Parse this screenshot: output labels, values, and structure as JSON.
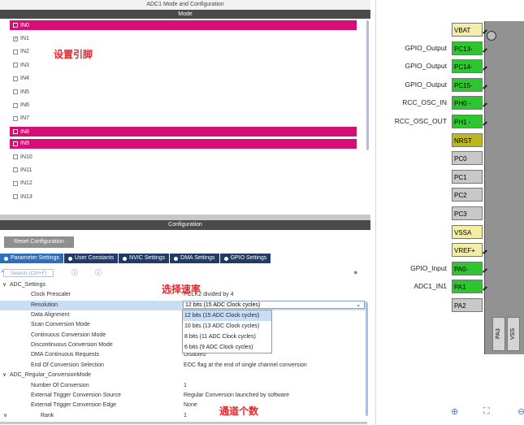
{
  "window_title": "ADC1 Mode and Configuration",
  "mode_header": "Mode",
  "channels": [
    {
      "label": "IN0",
      "selected": true,
      "checked": false
    },
    {
      "label": "IN1",
      "selected": false,
      "checked": true
    },
    {
      "label": "IN2",
      "selected": false,
      "checked": false
    },
    {
      "label": "IN3",
      "selected": false,
      "checked": false
    },
    {
      "label": "IN4",
      "selected": false,
      "checked": false
    },
    {
      "label": "IN5",
      "selected": false,
      "checked": false
    },
    {
      "label": "IN6",
      "selected": false,
      "checked": false
    },
    {
      "label": "IN7",
      "selected": false,
      "checked": false
    },
    {
      "label": "IN8",
      "selected": true,
      "checked": false
    },
    {
      "label": "IN9",
      "selected": true,
      "checked": false
    },
    {
      "label": "IN10",
      "selected": false,
      "checked": false
    },
    {
      "label": "IN11",
      "selected": false,
      "checked": false
    },
    {
      "label": "IN12",
      "selected": false,
      "checked": false
    },
    {
      "label": "IN13",
      "selected": false,
      "checked": false
    }
  ],
  "annotations": {
    "set_pin": "设置引脚",
    "select_speed": "选择速率",
    "channel_count": "通道个数"
  },
  "config_header": "Configuration",
  "reset_label": "Reset Configuration",
  "tabs": [
    "Parameter Settings",
    "User Constants",
    "NVIC Settings",
    "DMA Settings",
    "GPIO Settings"
  ],
  "search_placeholder": "Search (Ctrl+F)",
  "params": [
    {
      "name": "ADC_Settings",
      "value": "",
      "level": 0,
      "group": true
    },
    {
      "name": "Clock Prescaler",
      "value": "PCLK2 divided by 4",
      "level": 1
    },
    {
      "name": "Resolution",
      "value": "12 bits (15 ADC Clock cycles)",
      "level": 1,
      "highlight": true
    },
    {
      "name": "Data Alignment",
      "value": "",
      "level": 1
    },
    {
      "name": "Scan Conversion Mode",
      "value": "",
      "level": 1
    },
    {
      "name": "Continuous Conversion Mode",
      "value": "",
      "level": 1
    },
    {
      "name": "Discontinuous Conversion Mode",
      "value": "",
      "level": 1
    },
    {
      "name": "DMA Continuous Requests",
      "value": "Disabled",
      "level": 1
    },
    {
      "name": "End Of Conversion Selection",
      "value": "EOC flag at the end of single channel conversion",
      "level": 1
    },
    {
      "name": "ADC_Regular_ConversionMode",
      "value": "",
      "level": 0,
      "group": true
    },
    {
      "name": "Number Of Conversion",
      "value": "1",
      "level": 1
    },
    {
      "name": "External Trigger Conversion Source",
      "value": "Regular Conversion launched by software",
      "level": 1
    },
    {
      "name": "External Trigger Conversion Edge",
      "value": "None",
      "level": 1
    },
    {
      "name": "Rank",
      "value": "1",
      "level": 2,
      "group": true
    }
  ],
  "resolution_options": [
    "12 bits (15 ADC Clock cycles)",
    "10 bits (13 ADC Clock cycles)",
    "8 bits (11 ADC Clock cycles)",
    "6 bits (9 ADC Clock cycles)"
  ],
  "resolution_selected": 0,
  "pins": [
    {
      "pin": "VBAT",
      "label": "",
      "color": "yellow"
    },
    {
      "pin": "PC13-",
      "label": "GPIO_Output",
      "color": "green"
    },
    {
      "pin": "PC14-",
      "label": "GPIO_Output",
      "color": "green"
    },
    {
      "pin": "PC15-",
      "label": "GPIO_Output",
      "color": "green"
    },
    {
      "pin": "PH0 -",
      "label": "RCC_OSC_IN",
      "color": "green"
    },
    {
      "pin": "PH1 -",
      "label": "RCC_OSC_OUT",
      "color": "green"
    },
    {
      "pin": "NRST",
      "label": "",
      "color": "olive"
    },
    {
      "pin": "PC0",
      "label": "",
      "color": "gray"
    },
    {
      "pin": "PC1",
      "label": "",
      "color": "gray"
    },
    {
      "pin": "PC2",
      "label": "",
      "color": "gray"
    },
    {
      "pin": "PC3",
      "label": "",
      "color": "gray"
    },
    {
      "pin": "VSSA",
      "label": "",
      "color": "yellow"
    },
    {
      "pin": "VREF+",
      "label": "",
      "color": "yellow"
    },
    {
      "pin": "PA0-",
      "label": "GPIO_Input",
      "color": "green"
    },
    {
      "pin": "PA1",
      "label": "ADC1_IN1",
      "color": "green"
    },
    {
      "pin": "PA2",
      "label": "",
      "color": "gray"
    }
  ],
  "bottom_pins": [
    "PA3",
    "VSS"
  ],
  "colors": {
    "selected_channel": "#d60f77",
    "pin_green": "#2ec62e",
    "annotation": "#e8262b",
    "tab_active": "#2b6fbe"
  }
}
